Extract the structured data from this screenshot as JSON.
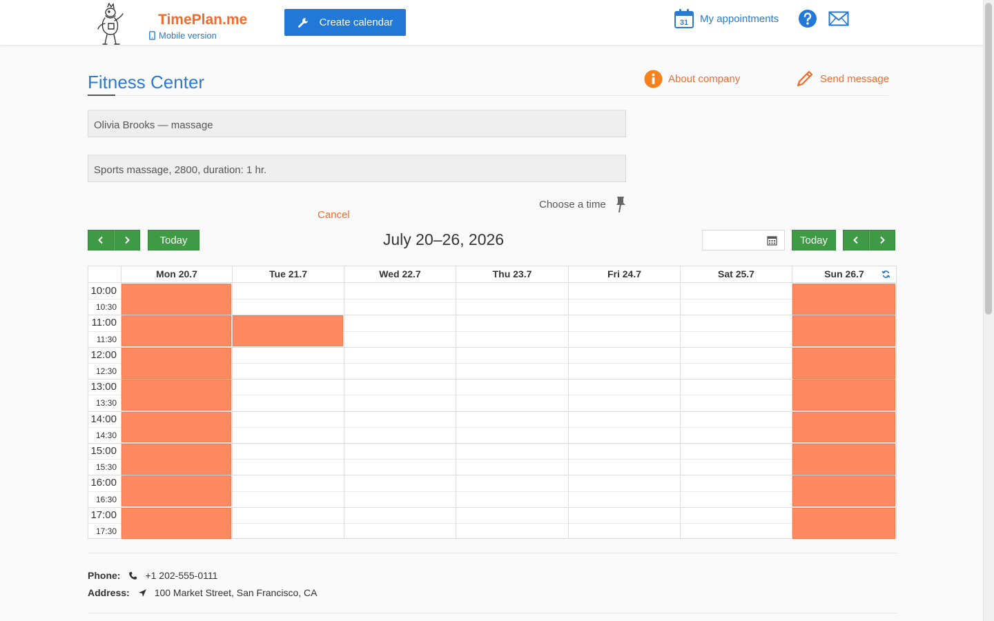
{
  "header": {
    "brand": "TimePlan.me",
    "mobile_link": "Mobile version",
    "create_button": "Create calendar",
    "my_appointments": "My appointments",
    "calendar_icon_day": "31"
  },
  "company": {
    "name": "Fitness Center",
    "about_link": "About company",
    "send_message_link": "Send message"
  },
  "booking": {
    "employee_select": "Olivia Brooks — massage",
    "service_select": "Sports massage, 2800, duration: 1 hr.",
    "choose_time": "Choose a time",
    "cancel": "Cancel"
  },
  "toolbar": {
    "today_left": "Today",
    "today_right": "Today",
    "week_title": "July 20–26, 2026"
  },
  "calendar": {
    "days": [
      "Mon 20.7",
      "Tue 21.7",
      "Wed 22.7",
      "Thu 23.7",
      "Fri 24.7",
      "Sat 25.7",
      "Sun 26.7"
    ],
    "times": [
      "10:00",
      "10:30",
      "11:00",
      "11:30",
      "12:00",
      "12:30",
      "13:00",
      "13:30",
      "14:00",
      "14:30",
      "15:00",
      "15:30",
      "16:00",
      "16:30",
      "17:00",
      "17:30"
    ],
    "busy": [
      {
        "day": 0,
        "from": "10:00",
        "to": "18:00"
      },
      {
        "day": 1,
        "from": "11:00",
        "to": "12:00"
      },
      {
        "day": 6,
        "from": "10:00",
        "to": "18:00"
      }
    ],
    "colors": {
      "busy": "#ff8a62",
      "grid": "#dcdcdc"
    }
  },
  "contacts": {
    "phone_label": "Phone:",
    "phone": "+1 202-555-0111",
    "address_label": "Address:",
    "address": "100 Market Street, San Francisco, CA"
  },
  "colors": {
    "brand_orange": "#f26a2e",
    "link_blue": "#2a7ad0",
    "button_blue": "#2278d6",
    "button_green": "#3f9a45"
  }
}
